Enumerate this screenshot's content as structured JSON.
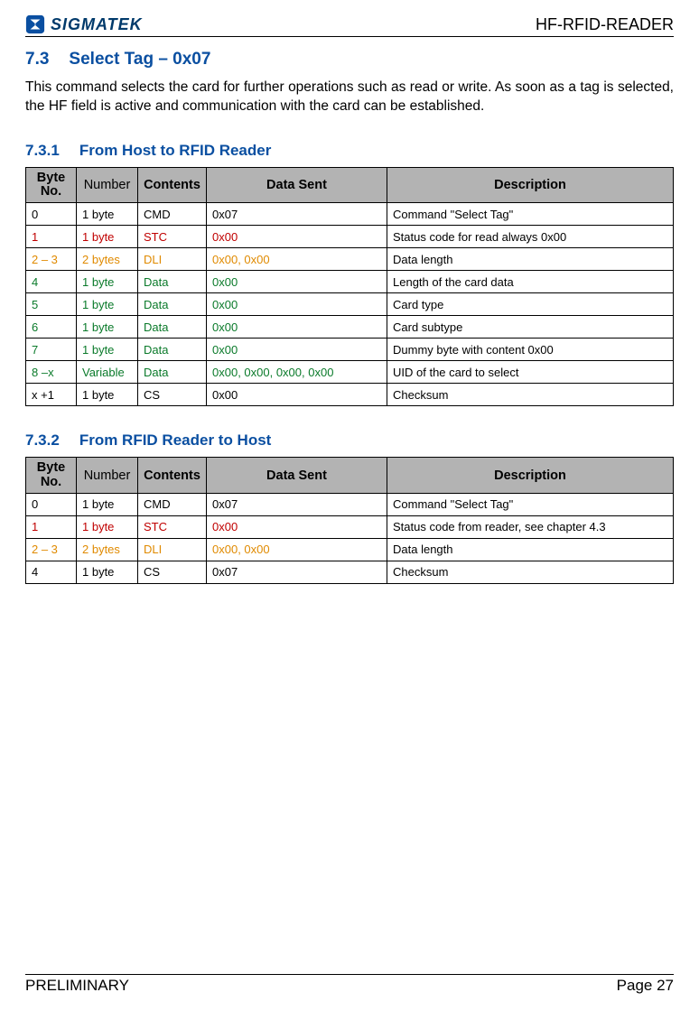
{
  "header": {
    "brand": "SIGMATEK",
    "doc_title": "HF-RFID-READER"
  },
  "section": {
    "number": "7.3",
    "title": "Select Tag – 0x07",
    "paragraph": "This command selects the card for further operations such as read or write. As soon as a tag is selected, the HF field is active and communication with the card can be established."
  },
  "sub1": {
    "number": "7.3.1",
    "title": "From Host to RFID Reader",
    "headers": {
      "byteno": "Byte No.",
      "number": "Number",
      "contents": "Contents",
      "datasent": "Data Sent",
      "description": "Description"
    },
    "rows": [
      {
        "color": "black",
        "byteno": "0",
        "number": "1 byte",
        "contents": "CMD",
        "datasent": "0x07",
        "description": "Command \"Select Tag\""
      },
      {
        "color": "red",
        "byteno": "1",
        "number": "1 byte",
        "contents": "STC",
        "datasent": "0x00",
        "description": "Status code for read always 0x00"
      },
      {
        "color": "orange",
        "byteno": "2 – 3",
        "number": "2 bytes",
        "contents": "DLI",
        "datasent": "0x00, 0x00",
        "description": "Data length"
      },
      {
        "color": "green",
        "byteno": "4",
        "number": "1 byte",
        "contents": "Data",
        "datasent": "0x00",
        "description": "Length of the card data"
      },
      {
        "color": "green",
        "byteno": "5",
        "number": "1 byte",
        "contents": "Data",
        "datasent": "0x00",
        "description": "Card type"
      },
      {
        "color": "green",
        "byteno": "6",
        "number": "1 byte",
        "contents": "Data",
        "datasent": "0x00",
        "description": "Card subtype"
      },
      {
        "color": "green",
        "byteno": "7",
        "number": "1 byte",
        "contents": "Data",
        "datasent": "0x00",
        "description": "Dummy byte with content 0x00"
      },
      {
        "color": "green",
        "byteno": "8 –x",
        "number": "Variable",
        "contents": "Data",
        "datasent": "0x00, 0x00, 0x00, 0x00",
        "description": "UID of the card to select"
      },
      {
        "color": "black",
        "byteno": "x +1",
        "number": "1 byte",
        "contents": "CS",
        "datasent": "0x00",
        "description": "Checksum"
      }
    ]
  },
  "sub2": {
    "number": "7.3.2",
    "title": "From RFID Reader to Host",
    "headers": {
      "byteno": "Byte No.",
      "number": "Number",
      "contents": "Contents",
      "datasent": "Data Sent",
      "description": "Description"
    },
    "rows": [
      {
        "color": "black",
        "byteno": "0",
        "number": "1 byte",
        "contents": "CMD",
        "datasent": "0x07",
        "description": "Command \"Select Tag\""
      },
      {
        "color": "red",
        "byteno": "1",
        "number": "1 byte",
        "contents": "STC",
        "datasent": "0x00",
        "description": "Status code from reader, see chapter 4.3"
      },
      {
        "color": "orange",
        "byteno": "2 – 3",
        "number": "2 bytes",
        "contents": "DLI",
        "datasent": "0x00, 0x00",
        "description": "Data length"
      },
      {
        "color": "black",
        "byteno": "4",
        "number": "1 byte",
        "contents": "CS",
        "datasent": "0x07",
        "description": "Checksum"
      }
    ]
  },
  "footer": {
    "left": "PRELIMINARY",
    "right": "Page 27"
  }
}
